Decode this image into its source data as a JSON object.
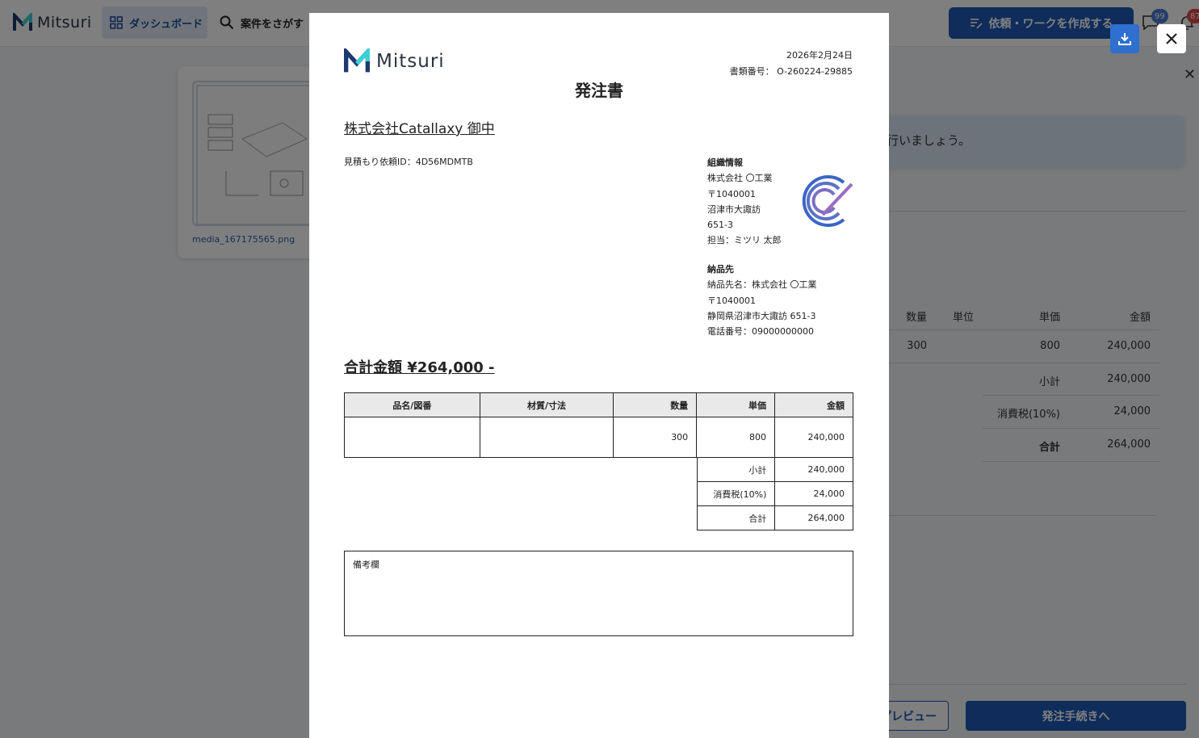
{
  "header": {
    "app_name": "Mitsuri",
    "nav_dashboard": "ダッシュボード",
    "nav_search": "案件をさがす",
    "create_button": "依頼・ワークを作成する",
    "messages_count": "99",
    "notifications_count": "87"
  },
  "background": {
    "file_name": "media_167175565.png",
    "alert_text": "行いましょう。",
    "table_headers": [
      "数量",
      "単位",
      "単価",
      "金額"
    ],
    "row": {
      "quantity": "300",
      "unit_price": "800",
      "amount": "240,000"
    },
    "subtotal_label": "小計",
    "subtotal": "240,000",
    "tax_label": "消費税(10%)",
    "tax": "24,000",
    "total_label": "合計",
    "total": "264,000",
    "preview_button": "プレビュー",
    "order_button": "発注手続きへ"
  },
  "document": {
    "logo_text": "Mitsuri",
    "date": "2026年2月24日",
    "doc_number": "書類番号： O-260224-29885",
    "title": "発注書",
    "recipient": "株式会社Catallaxy 御中",
    "request_id": "見積もり依頼ID：4D56MDMTB",
    "org": {
      "heading": "組織情報",
      "company": "株式会社 〇工業",
      "postal": "〒1040001",
      "address1": "沼津市大諏訪",
      "address2": "651-3",
      "contact": "担当：ミツリ 太郎"
    },
    "delivery": {
      "heading": "納品先",
      "name": "納品先名：株式会社 〇工業",
      "postal": "〒1040001",
      "address": "静岡県沼津市大諏訪 651-3",
      "phone": "電話番号：09000000000"
    },
    "total_amount": "合計金額 ¥264,000 -",
    "table": {
      "headers": [
        "品名/図番",
        "材質/寸法",
        "数量",
        "単価",
        "金額"
      ],
      "rows": [
        [
          "",
          "",
          "300",
          "800",
          "240,000"
        ]
      ]
    },
    "sums": [
      {
        "label": "小計",
        "value": "240,000"
      },
      {
        "label": "消費税(10%)",
        "value": "24,000"
      },
      {
        "label": "合計",
        "value": "264,000"
      }
    ],
    "remarks_label": "備考欄"
  },
  "icons": {
    "download": "download-icon",
    "close": "close-icon",
    "seal": "company-seal-icon"
  },
  "colors": {
    "brand_blue": "#1f58b5",
    "overlay": "rgba(0,0,0,0.5)"
  }
}
